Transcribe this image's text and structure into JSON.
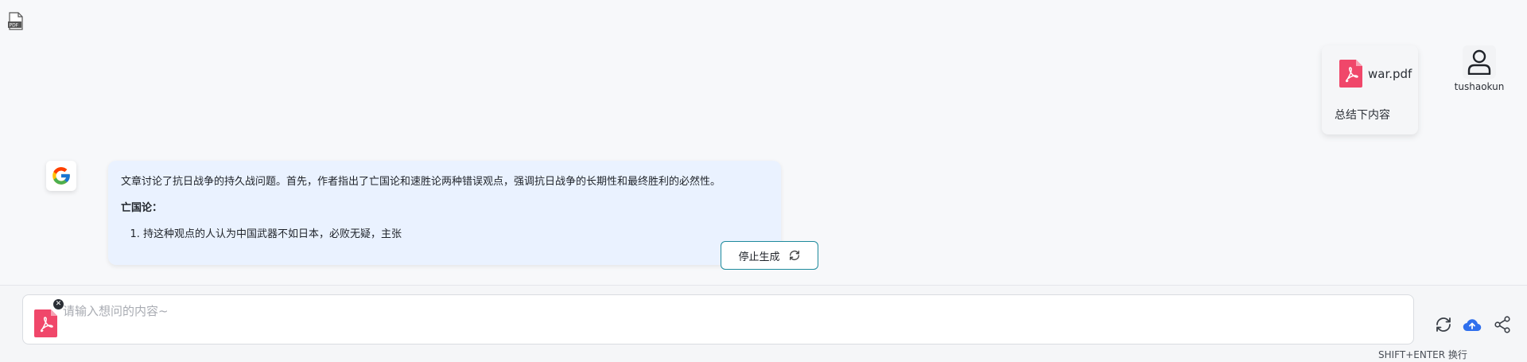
{
  "header": {
    "corner_icon": "pdf-file-icon"
  },
  "user_message": {
    "file_name": "war.pdf",
    "file_icon": "pdf-file-icon",
    "text": "总结下内容",
    "username": "tushaokun",
    "avatar_icon": "user-person-icon"
  },
  "assistant_message": {
    "avatar_icon": "google-logo-icon",
    "paragraph": "文章讨论了抗日战争的持久战问题。首先，作者指出了亡国论和速胜论两种错误观点，强调抗日战争的长期性和最终胜利的必然性。",
    "heading": "亡国论：",
    "list_items": [
      "持这种观点的人认为中国武器不如日本，必败无疑，主张"
    ]
  },
  "stop_button": {
    "label": "停止生成",
    "icon": "refresh-icon"
  },
  "input": {
    "placeholder": "请输入想问的内容~",
    "value": "",
    "attachment_icon": "pdf-file-icon",
    "remove_icon": "close-icon"
  },
  "toolbar": {
    "refresh_icon": "refresh-icon",
    "upload_icon": "cloud-upload-icon",
    "share_icon": "share-icon"
  },
  "hint": "SHIFT+ENTER 换行",
  "colors": {
    "pdf_red": "#f0476a",
    "bubble_bg": "#eaf2ff",
    "stop_border": "#1d8a9c",
    "upload_blue": "#2f6fed"
  }
}
